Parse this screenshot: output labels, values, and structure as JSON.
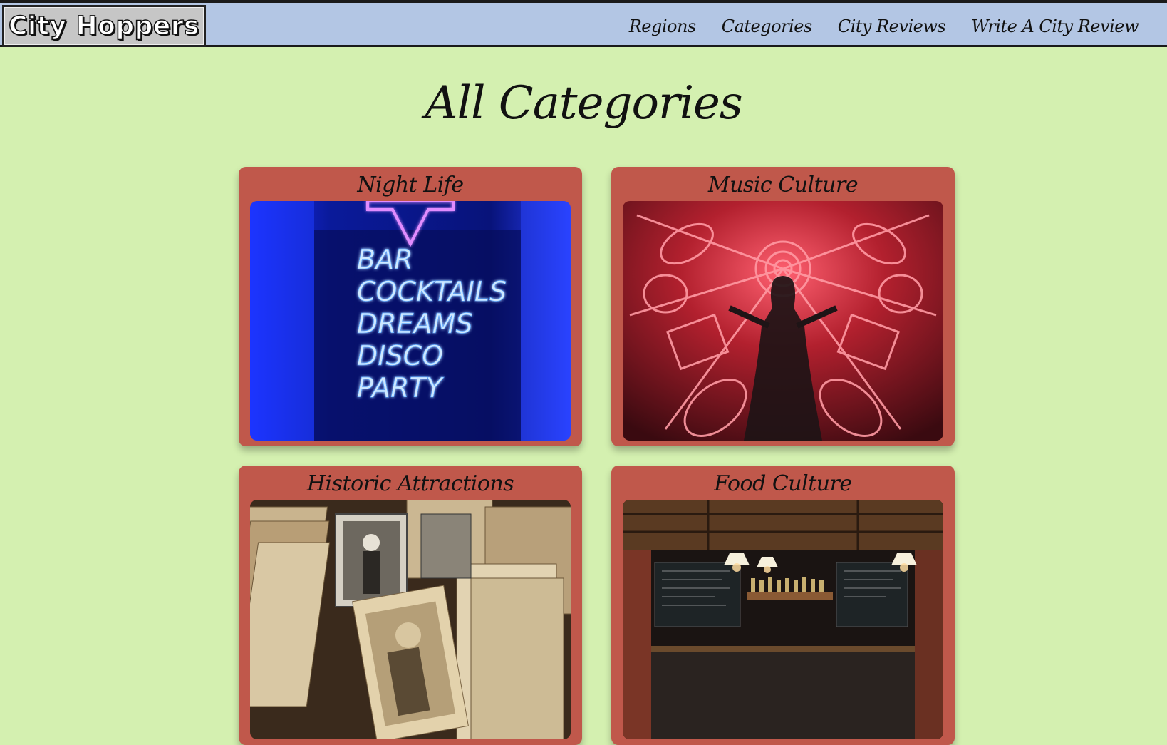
{
  "header": {
    "logo": "City Hoppers",
    "nav": [
      {
        "label": "Regions"
      },
      {
        "label": "Categories"
      },
      {
        "label": "City Reviews"
      },
      {
        "label": "Write A City Review"
      }
    ]
  },
  "main": {
    "title": "All Categories",
    "cards": [
      {
        "title": "Night Life",
        "image_icon": "neon-bar-sign-photo",
        "image_text": [
          "BAR",
          "COCKTAILS",
          "DREAMS",
          "DISCO",
          "PARTY"
        ]
      },
      {
        "title": "Music Culture",
        "image_icon": "neon-instruments-photo"
      },
      {
        "title": "Historic Attractions",
        "image_icon": "vintage-photographs-photo"
      },
      {
        "title": "Food Culture",
        "image_icon": "restaurant-bar-interior-photo"
      }
    ]
  },
  "colors": {
    "page_background": "#d4f0b0",
    "header_background": "#b3c6e4",
    "card_background": "#c0584b",
    "text": "#111111"
  }
}
